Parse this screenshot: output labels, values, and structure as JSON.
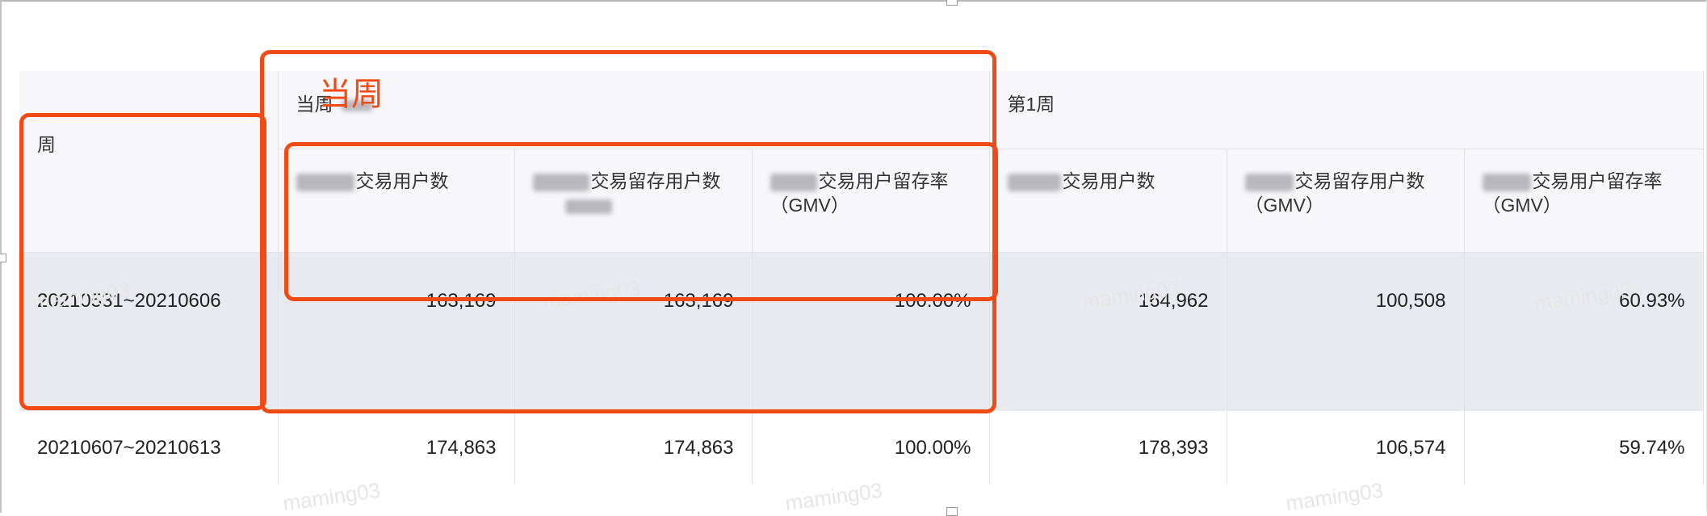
{
  "table": {
    "week_header": "周",
    "groups": [
      {
        "label": "当周"
      },
      {
        "label": "第1周"
      }
    ],
    "sub_headers": [
      {
        "text": "交易用户数"
      },
      {
        "text": "交易留存用户数"
      },
      {
        "text": "交易用户留存率",
        "sub": "（GMV）"
      },
      {
        "text": "交易用户数"
      },
      {
        "text": "交易留存用户数",
        "sub": "（GMV）"
      },
      {
        "text": "交易用户留存率",
        "sub": "（GMV）"
      }
    ],
    "rows": [
      {
        "week": "20210531~20210606",
        "cells": [
          "163,169",
          "163,169",
          "100.00%",
          "164,962",
          "100,508",
          "60.93%"
        ]
      },
      {
        "week": "20210607~20210613",
        "cells": [
          "174,863",
          "174,863",
          "100.00%",
          "178,393",
          "106,574",
          "59.74%"
        ]
      }
    ]
  },
  "annotation": {
    "label": "当周",
    "color": "#f24a15"
  },
  "watermark": {
    "text": "maming03"
  },
  "colors": {
    "header_bg": "#f7f7f9",
    "highlight_row_bg": "#e9e9f0",
    "border": "#e1e2e8"
  }
}
